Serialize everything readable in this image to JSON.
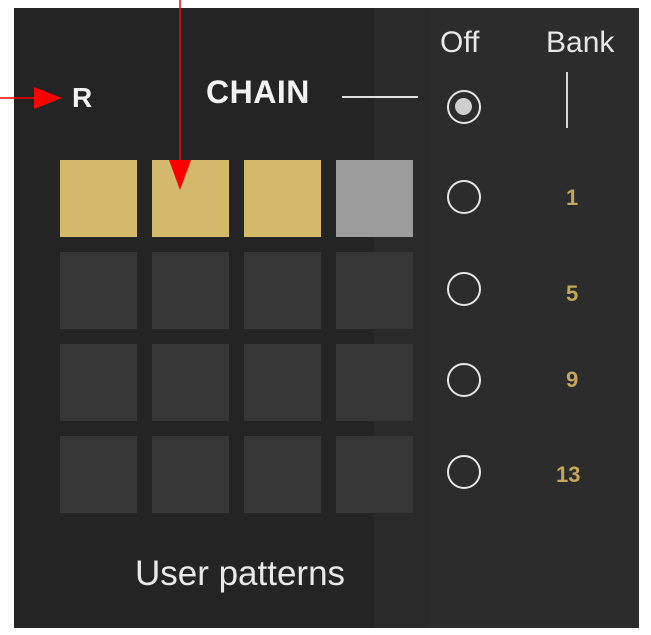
{
  "labels": {
    "r": "R",
    "chain": "CHAIN",
    "off": "Off",
    "bank": "Bank",
    "footer": "User patterns"
  },
  "grid": {
    "rows": [
      [
        "on",
        "on",
        "on",
        "chain-end"
      ],
      [
        "off",
        "off",
        "off",
        "off"
      ],
      [
        "off",
        "off",
        "off",
        "off"
      ],
      [
        "off",
        "off",
        "off",
        "off"
      ]
    ]
  },
  "banks": {
    "selected": "off",
    "numbers": [
      "1",
      "5",
      "9",
      "13"
    ]
  },
  "colors": {
    "pad_active": "#d4b96a",
    "pad_chain_end": "#9c9c9c",
    "pad_inactive": "#363636",
    "bank_number": "#c2a659",
    "annotation_arrow": "#ff0000"
  }
}
